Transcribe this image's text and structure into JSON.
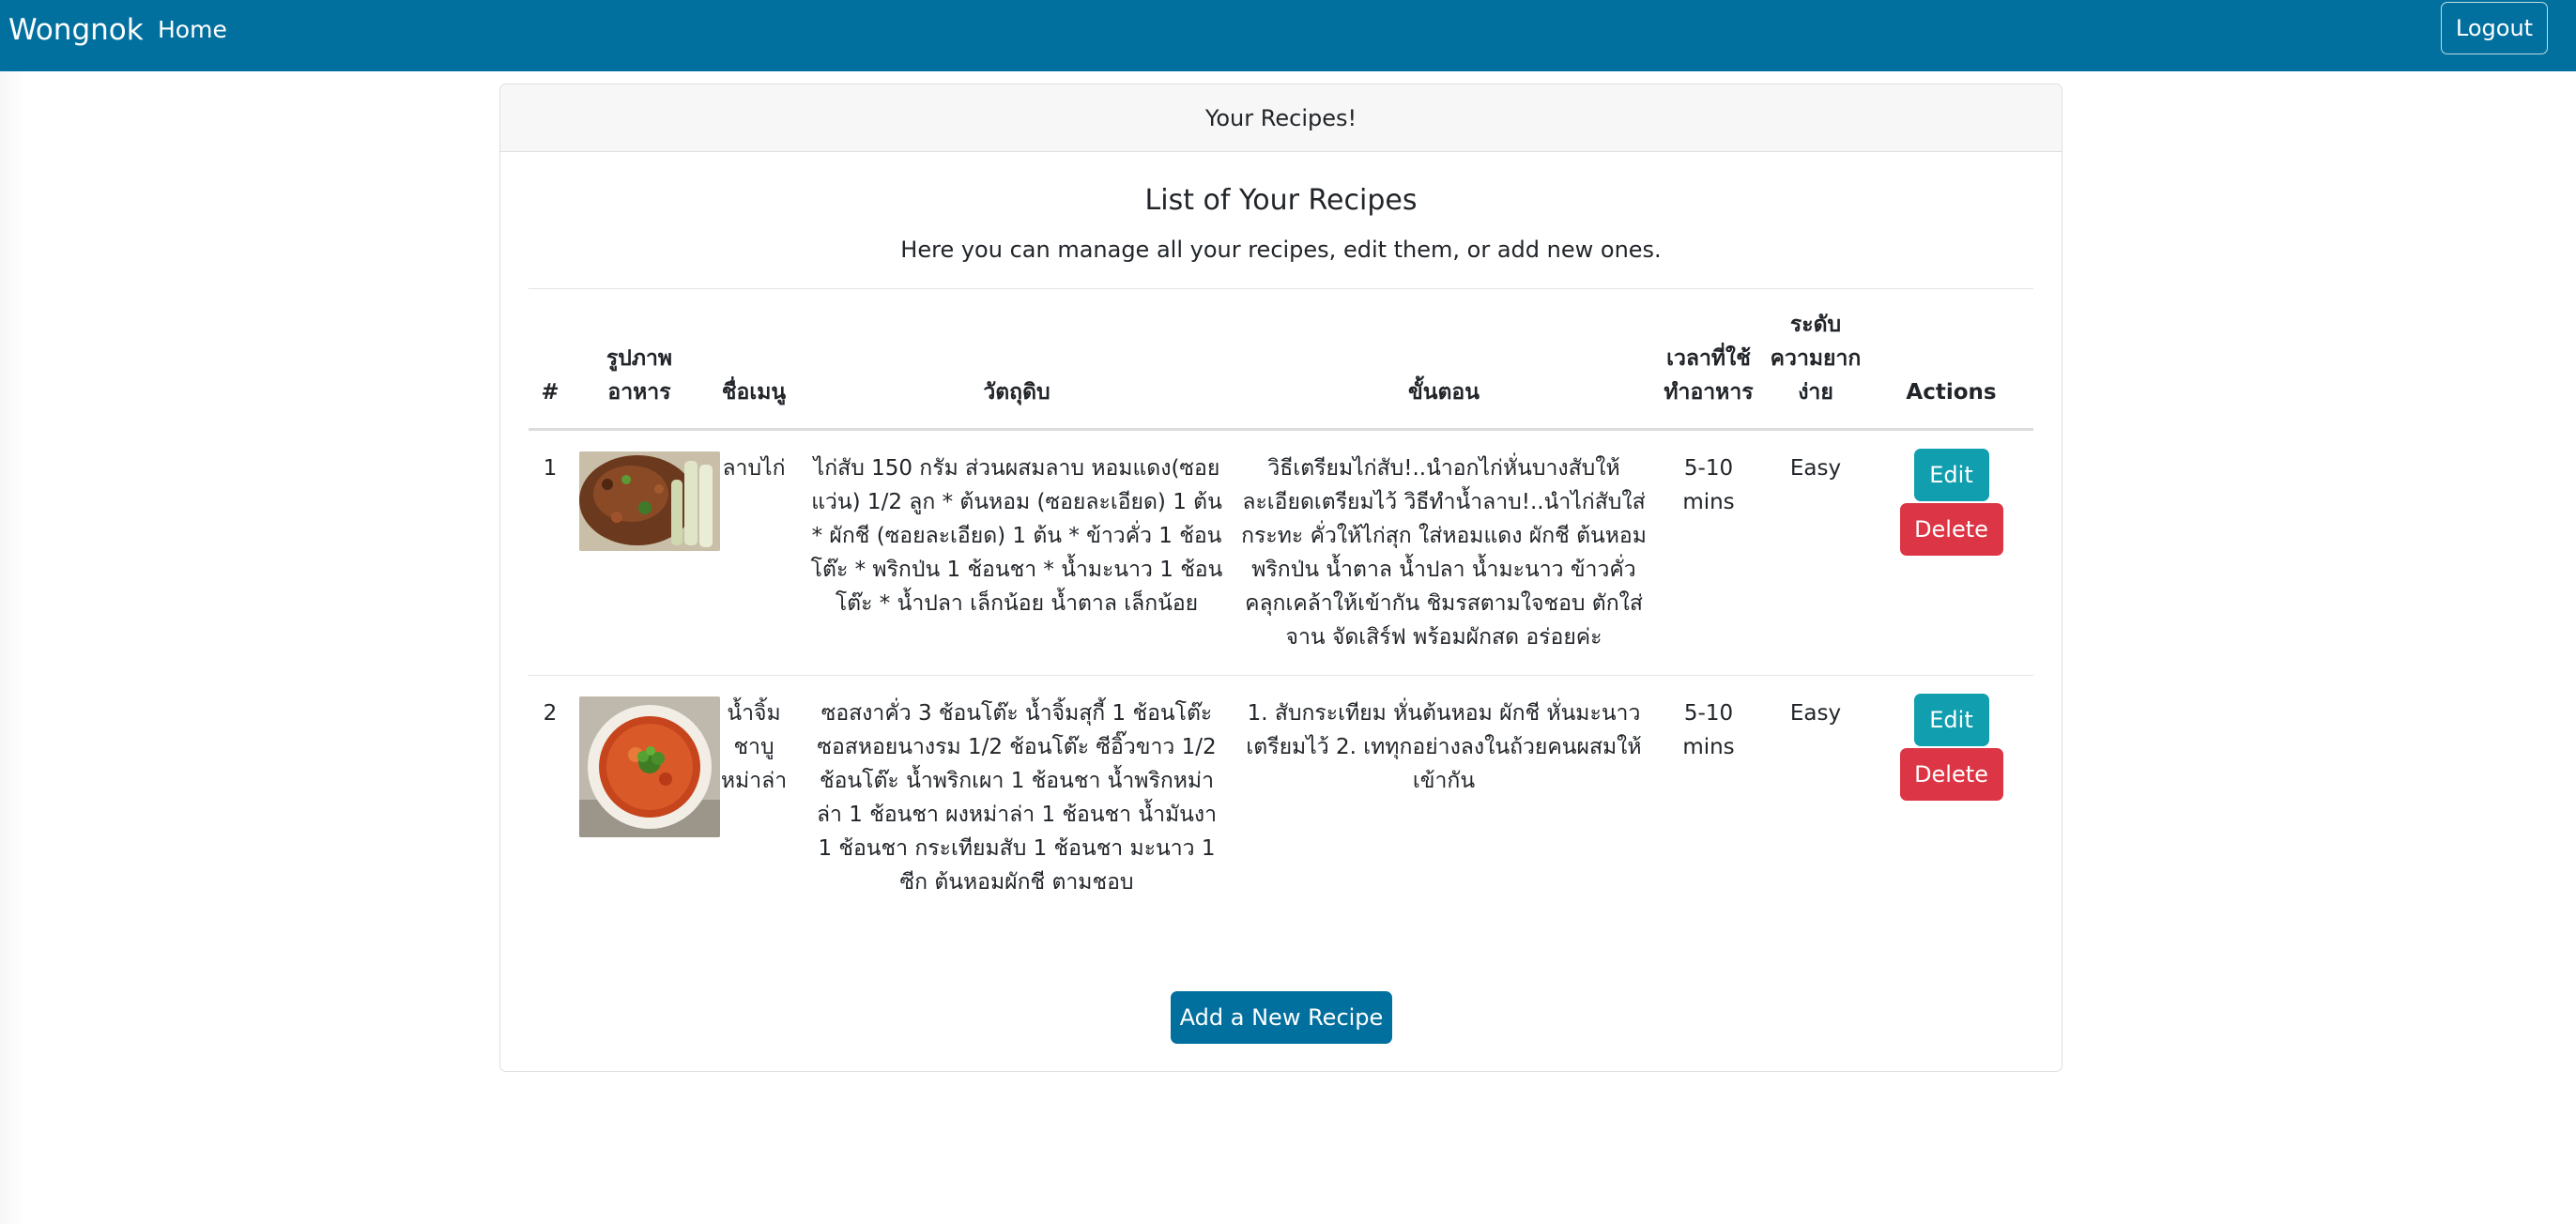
{
  "nav": {
    "brand": "Wongnok",
    "home": "Home",
    "logout": "Logout"
  },
  "card": {
    "header": "Your Recipes!",
    "title": "List of Your Recipes",
    "subtitle": "Here you can manage all your recipes, edit them, or add new ones."
  },
  "table": {
    "headers": [
      "#",
      "รูปภาพอาหาร",
      "ชื่อเมนู",
      "วัตถุดิบ",
      "ขั้นตอน",
      "เวลาที่ใช้ทำอาหาร",
      "ระดับความยากง่าย",
      "Actions"
    ],
    "rows": [
      {
        "num": "1",
        "image": "larb-gai-photo",
        "name": "ลาบไก่",
        "ingredients": "ไก่สับ 150 กรัม ส่วนผสมลาบ หอมแดง(ซอยแว่น) 1/2 ลูก * ต้นหอม (ซอยละเอียด) 1 ต้น * ผักชี (ซอยละเอียด) 1 ต้น * ข้าวคั่ว 1 ช้อนโต๊ะ * พริกป่น 1 ช้อนชา * น้ำมะนาว 1 ช้อนโต๊ะ * น้ำปลา เล็กน้อย น้ำตาล เล็กน้อย",
        "steps": "วิธีเตรียมไก่สับ!..นำอกไก่หั่นบางสับให้ละเอียดเตรียมไว้ วิธีทำน้ำลาบ!..นำไก่สับใส่กระทะ คั่วให้ไก่สุก ใส่หอมแดง ผักชี ต้นหอม พริกป่น น้ำตาล น้ำปลา น้ำมะนาว ข้าวคั่ว คลุกเคล้าให้เข้ากัน ชิมรสตามใจชอบ ตักใส่จาน จัดเสิร์ฟ พร้อมผักสด อร่อยค่ะ",
        "time": "5-10 mins",
        "difficulty": "Easy"
      },
      {
        "num": "2",
        "image": "nam-jim-suki-photo",
        "name": "น้ำจิ้มชาบูหม่าล่า",
        "ingredients": "ซอสงาคั่ว 3 ช้อนโต๊ะ น้ำจิ้มสุกี้ 1 ช้อนโต๊ะ ซอสหอยนางรม 1/2 ช้อนโต๊ะ ซีอิ๊วขาว 1/2 ช้อนโต๊ะ น้ำพริกเผา 1 ช้อนชา น้ำพริกหม่าล่า 1 ช้อนชา ผงหม่าล่า 1 ช้อนชา น้ำมันงา 1 ช้อนชา กระเทียมสับ 1 ช้อนชา มะนาว 1 ซีก ต้นหอมผักชี ตามชอบ",
        "steps": "1. สับกระเทียม หั่นต้นหอม ผักชี หั่นมะนาว เตรียมไว้ 2. เททุกอย่างลงในถ้วยคนผสมให้เข้ากัน",
        "time": "5-10 mins",
        "difficulty": "Easy"
      }
    ],
    "edit_label": "Edit",
    "delete_label": "Delete"
  },
  "add_button": "Add a New Recipe",
  "colors": {
    "navbar": "#02709e",
    "edit": "#119eaf",
    "delete": "#dc3545",
    "primary": "#02709e"
  }
}
